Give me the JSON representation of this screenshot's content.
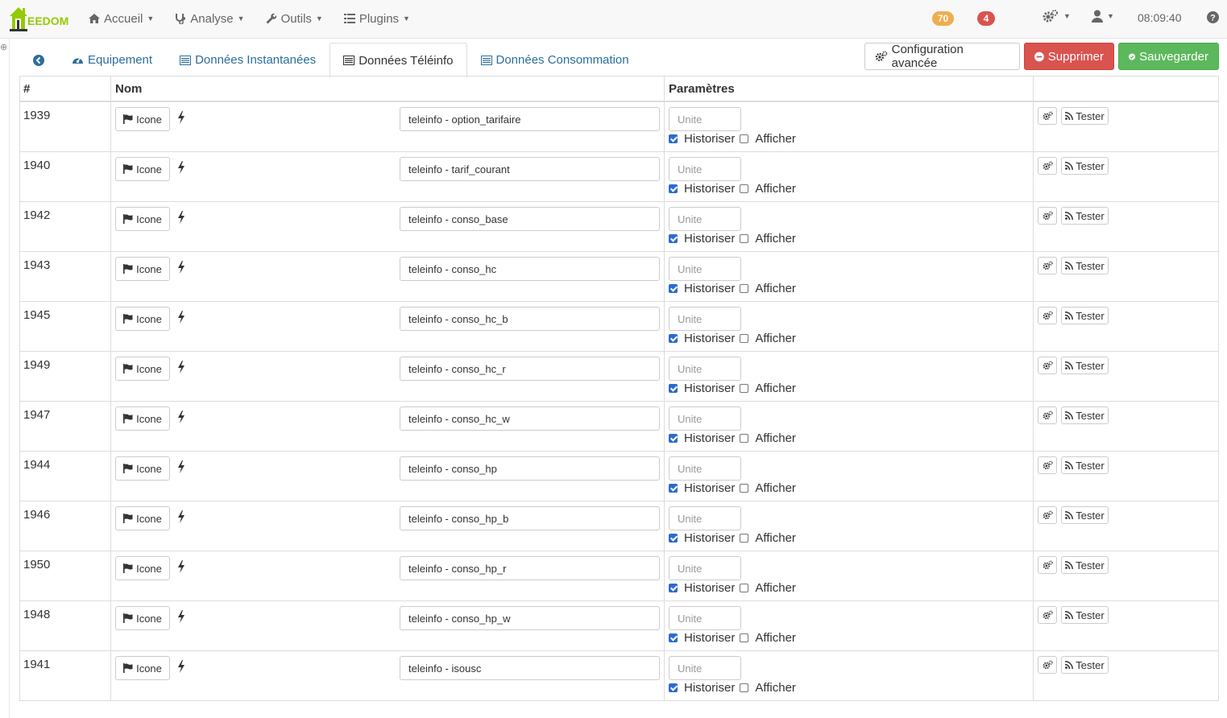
{
  "app": {
    "logo_text": "EEDOM"
  },
  "navbar": {
    "menu": [
      {
        "label": "Accueil",
        "icon": "home-icon"
      },
      {
        "label": "Analyse",
        "icon": "stethoscope-icon"
      },
      {
        "label": "Outils",
        "icon": "wrench-icon"
      },
      {
        "label": "Plugins",
        "icon": "tasks-icon"
      }
    ],
    "badge_warning": "70",
    "badge_danger": "4",
    "clock": "08:09:40",
    "colors": {
      "warning": "#f0ad4e",
      "danger": "#d9534f",
      "brand": "#94ca02"
    }
  },
  "tabs": [
    {
      "label": "",
      "icon": "back-arrow-circle-icon"
    },
    {
      "label": "Equipement",
      "icon": "dashboard-icon"
    },
    {
      "label": "Données Instantanées",
      "icon": "list-alt-icon"
    },
    {
      "label": "Données Téléinfo",
      "icon": "list-alt-icon",
      "active": true
    },
    {
      "label": "Données Consommation",
      "icon": "list-alt-icon"
    }
  ],
  "actions": {
    "config_label": "Configuration avancée",
    "delete_label": "Supprimer",
    "save_label": "Sauvegarder"
  },
  "table": {
    "headers": {
      "id": "#",
      "name": "Nom",
      "params": "Paramètres",
      "actions": ""
    },
    "icon_button_label": "Icone",
    "unit_placeholder": "Unite",
    "historize_label": "Historiser",
    "display_label": "Afficher",
    "test_label": "Tester",
    "rows": [
      {
        "id": "1939",
        "name": "teleinfo - option_tarifaire",
        "historize": true,
        "display": false
      },
      {
        "id": "1940",
        "name": "teleinfo - tarif_courant",
        "historize": true,
        "display": false
      },
      {
        "id": "1942",
        "name": "teleinfo - conso_base",
        "historize": true,
        "display": false
      },
      {
        "id": "1943",
        "name": "teleinfo - conso_hc",
        "historize": true,
        "display": false
      },
      {
        "id": "1945",
        "name": "teleinfo - conso_hc_b",
        "historize": true,
        "display": false
      },
      {
        "id": "1949",
        "name": "teleinfo - conso_hc_r",
        "historize": true,
        "display": false
      },
      {
        "id": "1947",
        "name": "teleinfo - conso_hc_w",
        "historize": true,
        "display": false
      },
      {
        "id": "1944",
        "name": "teleinfo - conso_hp",
        "historize": true,
        "display": false
      },
      {
        "id": "1946",
        "name": "teleinfo - conso_hp_b",
        "historize": true,
        "display": false
      },
      {
        "id": "1950",
        "name": "teleinfo - conso_hp_r",
        "historize": true,
        "display": false
      },
      {
        "id": "1948",
        "name": "teleinfo - conso_hp_w",
        "historize": true,
        "display": false
      },
      {
        "id": "1941",
        "name": "teleinfo - isousc",
        "historize": true,
        "display": false
      }
    ]
  }
}
